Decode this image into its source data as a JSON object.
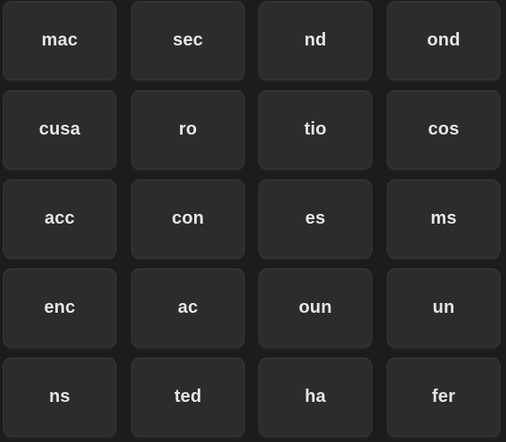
{
  "board": {
    "tiles": [
      "mac",
      "sec",
      "nd",
      "ond",
      "cusa",
      "ro",
      "tio",
      "cos",
      "acc",
      "con",
      "es",
      "ms",
      "enc",
      "ac",
      "oun",
      "un",
      "ns",
      "ted",
      "ha",
      "fer"
    ]
  },
  "colors": {
    "background": "#1c1c1e",
    "tile": "#2c2c2e",
    "text": "#e6e6e6"
  }
}
